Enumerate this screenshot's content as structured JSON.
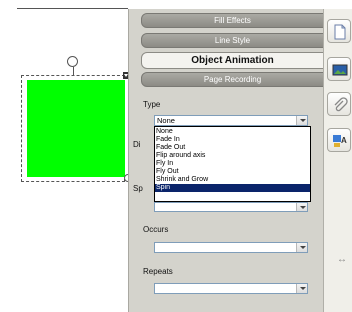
{
  "panel": {
    "tabs": [
      {
        "label": "Fill Effects"
      },
      {
        "label": "Line Style"
      },
      {
        "label": "Object Animation"
      },
      {
        "label": "Page Recording"
      }
    ],
    "type_label": "Type",
    "type_value": "None",
    "direction_label_partial": "Di",
    "speed_label_partial": "Sp",
    "occurs_label": "Occurs",
    "occurs_value": "",
    "repeats_label": "Repeats",
    "repeats_value": "",
    "type_options": [
      "None",
      "Fade In",
      "Fade Out",
      "Flip around axis",
      "Fly In",
      "Fly Out",
      "Shrink and Grow",
      "Spin"
    ],
    "selected_option": "Spin"
  },
  "colors": {
    "shape_fill": "#00ff00",
    "selection_highlight": "#0a246a"
  },
  "icons": [
    "page-icon",
    "image-icon",
    "paperclip-icon",
    "properties-icon",
    "resize-arrows-icon"
  ],
  "resize_glyph": "↔"
}
